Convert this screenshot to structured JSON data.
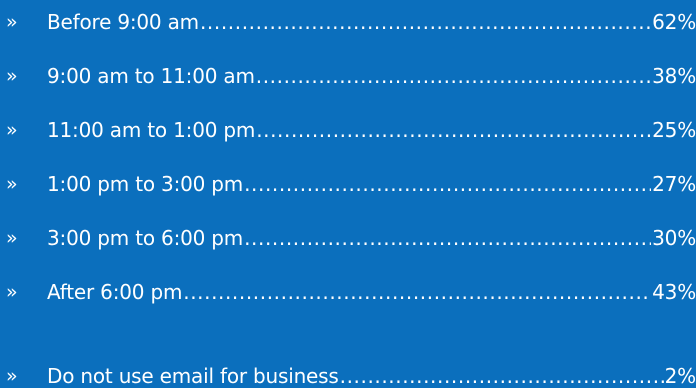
{
  "bullet_glyph": "»",
  "leader_dots": "..........................................................................................................................................................................................................",
  "rows": [
    {
      "label": "Before 9:00 am",
      "value": "62%"
    },
    {
      "label": "9:00 am to 11:00 am",
      "value": "38%"
    },
    {
      "label": "11:00 am to 1:00 pm",
      "value": "25%"
    },
    {
      "label": "1:00 pm to 3:00 pm",
      "value": "27%"
    },
    {
      "label": "3:00 pm to 6:00 pm",
      "value": "30%"
    },
    {
      "label": "After 6:00 pm",
      "value": "43%"
    },
    {
      "label": "Do not use email for business",
      "value": "2%"
    }
  ],
  "colors": {
    "background": "#0b6fbd",
    "text": "#ffffff"
  }
}
